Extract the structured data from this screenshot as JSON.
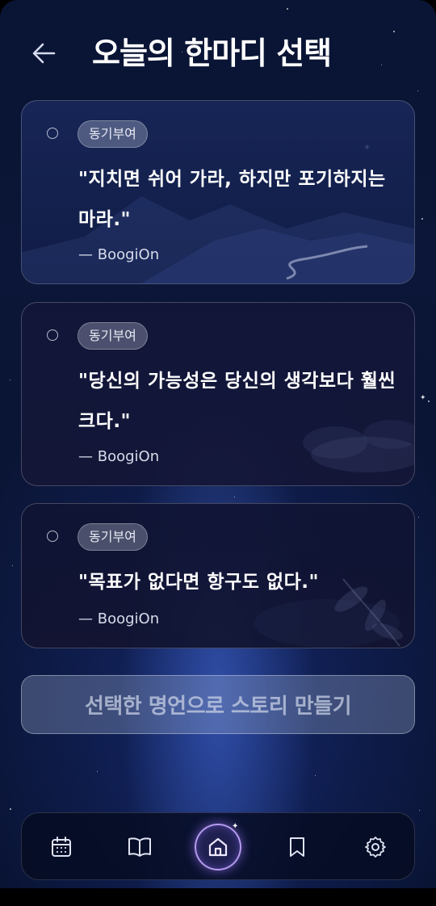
{
  "header": {
    "title": "오늘의 한마디 선택"
  },
  "quotes": [
    {
      "tag": "동기부여",
      "text": "\"지치면 쉬어 가라, 하지만 포기하지는 마라.\"",
      "author": "— BoogiOn"
    },
    {
      "tag": "동기부여",
      "text": "\"당신의 가능성은 당신의 생각보다 훨씬 크다.\"",
      "author": "— BoogiOn"
    },
    {
      "tag": "동기부여",
      "text": "\"목표가 없다면 항구도 없다.\"",
      "author": "— BoogiOn"
    }
  ],
  "cta": {
    "label": "선택한 명언으로 스토리 만들기"
  },
  "nav": {
    "active": "home"
  },
  "colors": {
    "accent": "#b89cff",
    "background": "#0a1434"
  }
}
